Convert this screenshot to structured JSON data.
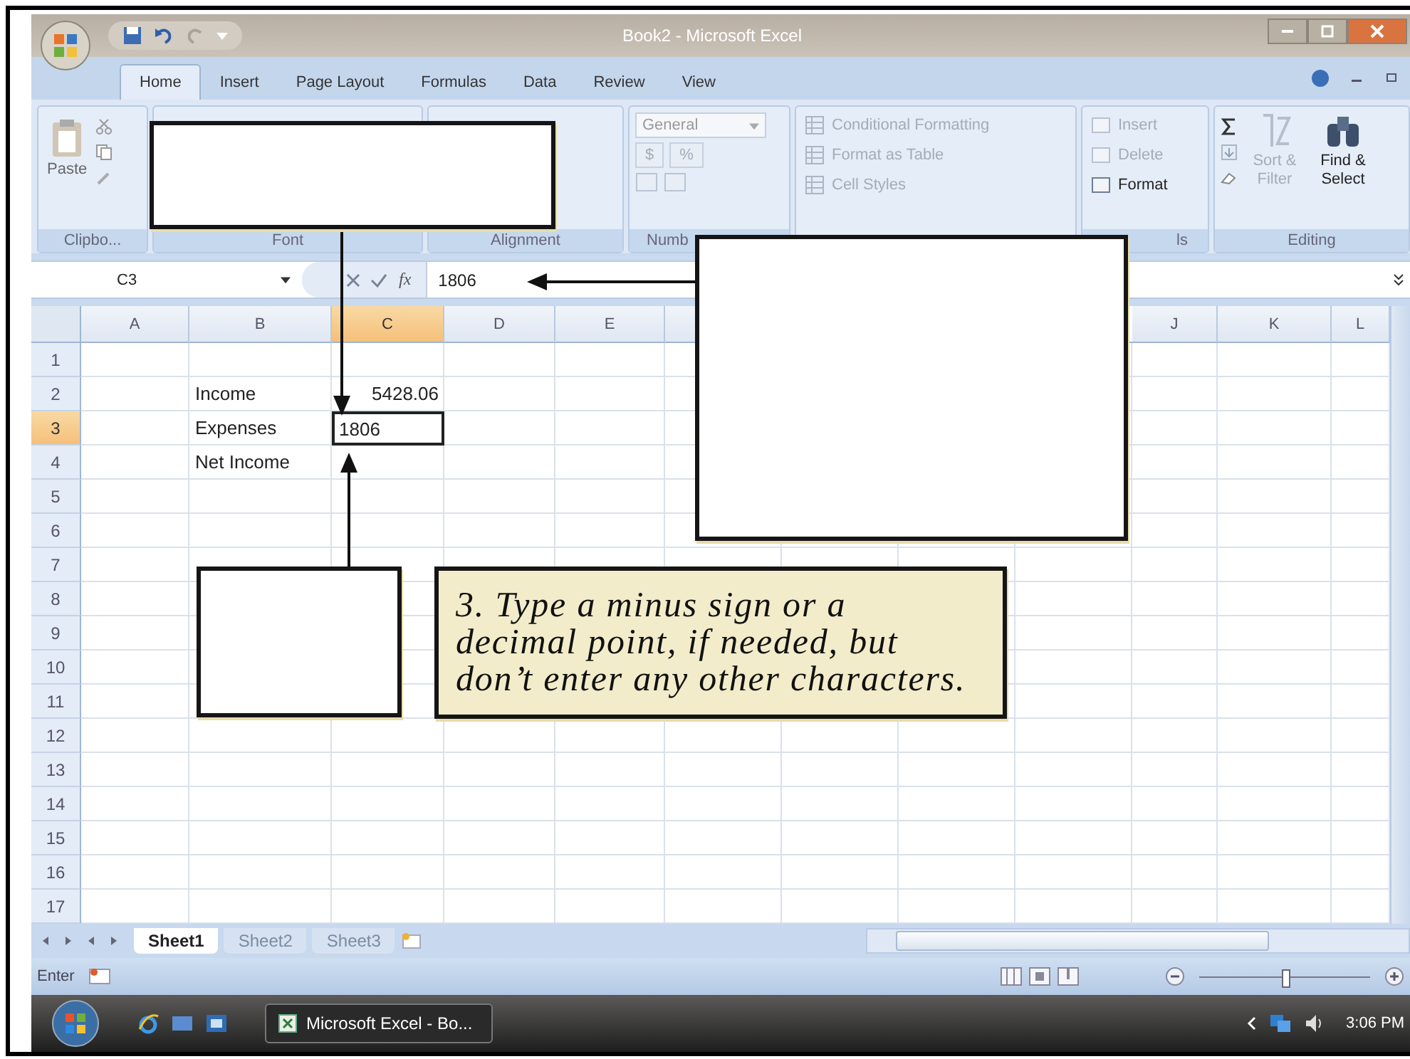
{
  "window": {
    "title": "Book2 - Microsoft Excel"
  },
  "ribbon_tabs": [
    {
      "label": "Home",
      "selected": true
    },
    {
      "label": "Insert",
      "selected": false
    },
    {
      "label": "Page Layout",
      "selected": false
    },
    {
      "label": "Formulas",
      "selected": false
    },
    {
      "label": "Data",
      "selected": false
    },
    {
      "label": "Review",
      "selected": false
    },
    {
      "label": "View",
      "selected": false
    }
  ],
  "ribbon": {
    "clipboard": {
      "paste": "Paste",
      "label": "Clipbo..."
    },
    "font": {
      "label": "Font"
    },
    "alignment": {
      "label": "Alignment"
    },
    "number": {
      "format": "General",
      "buttons": [
        "$",
        "%"
      ],
      "label": "Numb"
    },
    "styles": [
      {
        "label": "Conditional Formatting",
        "disabled": true
      },
      {
        "label": "Format as Table",
        "disabled": true
      },
      {
        "label": "Cell Styles",
        "disabled": true
      }
    ],
    "cells": {
      "commands": [
        {
          "label": "Insert",
          "disabled": true
        },
        {
          "label": "Delete",
          "disabled": true
        },
        {
          "label": "Format",
          "disabled": false
        }
      ],
      "label": "ls"
    },
    "editing": {
      "commands": [
        {
          "label": "Sort & Filter",
          "disabled": true
        },
        {
          "label": "Find & Select",
          "disabled": false
        }
      ],
      "label": "Editing"
    }
  },
  "formula_bar": {
    "name_box": "C3",
    "function_label": "fx",
    "value": "1806"
  },
  "column_headers": {
    "left": [
      {
        "label": "A",
        "selected": false
      },
      {
        "label": "B",
        "selected": false
      },
      {
        "label": "C",
        "selected": true
      },
      {
        "label": "D",
        "selected": false
      },
      {
        "label": "E",
        "selected": false
      }
    ],
    "right": [
      {
        "label": "J",
        "selected": false
      },
      {
        "label": "K",
        "selected": false
      },
      {
        "label": "L",
        "selected": false
      }
    ]
  },
  "rows": [
    {
      "number": "1",
      "selected": false
    },
    {
      "number": "2",
      "selected": false,
      "column_b": {
        "text": "Income",
        "active": false
      },
      "column_c": {
        "text": "5428.06",
        "active": false
      }
    },
    {
      "number": "3",
      "selected": true,
      "column_b": {
        "text": "Expenses",
        "active": false
      },
      "column_c": {
        "text": "1806",
        "active": true
      }
    },
    {
      "number": "4",
      "selected": false,
      "column_b": {
        "text": "Net Income",
        "active": false
      }
    },
    {
      "number": "5",
      "selected": false
    },
    {
      "number": "6",
      "selected": false
    },
    {
      "number": "7",
      "selected": false
    },
    {
      "number": "8",
      "selected": false
    },
    {
      "number": "9",
      "selected": false
    },
    {
      "number": "10",
      "selected": false
    },
    {
      "number": "11",
      "selected": false
    },
    {
      "number": "12",
      "selected": false
    },
    {
      "number": "13",
      "selected": false
    },
    {
      "number": "14",
      "selected": false
    },
    {
      "number": "15",
      "selected": false
    },
    {
      "number": "16",
      "selected": false
    },
    {
      "number": "17",
      "selected": false
    }
  ],
  "sheet_tabs": [
    {
      "label": "Sheet1",
      "selected": true
    },
    {
      "label": "Sheet2",
      "selected": false
    },
    {
      "label": "Sheet3",
      "selected": false
    }
  ],
  "status_bar": {
    "mode": "Enter",
    "zoom": {
      "level": 0.5
    }
  },
  "taskbar": {
    "window_button": "Microsoft Excel - Bo...",
    "clock": "3:06 PM"
  },
  "callouts": [
    {
      "kind": "blank"
    },
    {
      "kind": "blank"
    },
    {
      "kind": "blank"
    },
    {
      "kind": "note",
      "text": "3. Type a minus sign or a\ndecimal point, if needed, but\ndon’t enter any other characters."
    }
  ]
}
